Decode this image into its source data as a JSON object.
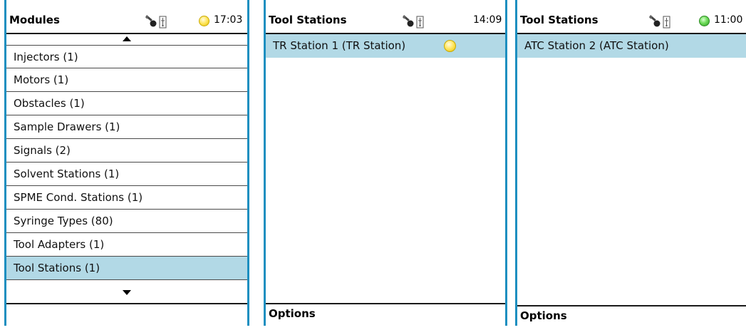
{
  "panels": {
    "modules": {
      "title": "Modules",
      "time": "17:03",
      "status": "yellow",
      "items": [
        {
          "label": "Injectors (1)"
        },
        {
          "label": "Motors (1)"
        },
        {
          "label": "Obstacles (1)"
        },
        {
          "label": "Sample Drawers (1)"
        },
        {
          "label": "Signals (2)"
        },
        {
          "label": "Solvent Stations (1)"
        },
        {
          "label": "SPME Cond. Stations (1)"
        },
        {
          "label": "Syringe Types (80)"
        },
        {
          "label": "Tool Adapters (1)"
        },
        {
          "label": "Tool Stations (1)",
          "selected": true
        }
      ]
    },
    "tool_stations_1": {
      "title": "Tool Stations",
      "time": "14:09",
      "items": [
        {
          "label": "TR Station 1 (TR Station)",
          "selected": true,
          "status": "yellow"
        }
      ],
      "options_label": "Options"
    },
    "tool_stations_2": {
      "title": "Tool Stations",
      "time": "11:00",
      "status": "green",
      "items": [
        {
          "label": "ATC Station 2 (ATC Station)",
          "selected": true
        }
      ],
      "options_label": "Options"
    }
  },
  "icons": {
    "key": "key-icon",
    "usb": "usb-icon",
    "scroll_up": "scroll-up-arrow-icon",
    "scroll_down": "scroll-down-arrow-icon"
  },
  "colors": {
    "panel_border": "#1d8fc0",
    "selection": "#b2d9e6",
    "status_yellow": "#ffe766",
    "status_green": "#6fdc5a"
  }
}
